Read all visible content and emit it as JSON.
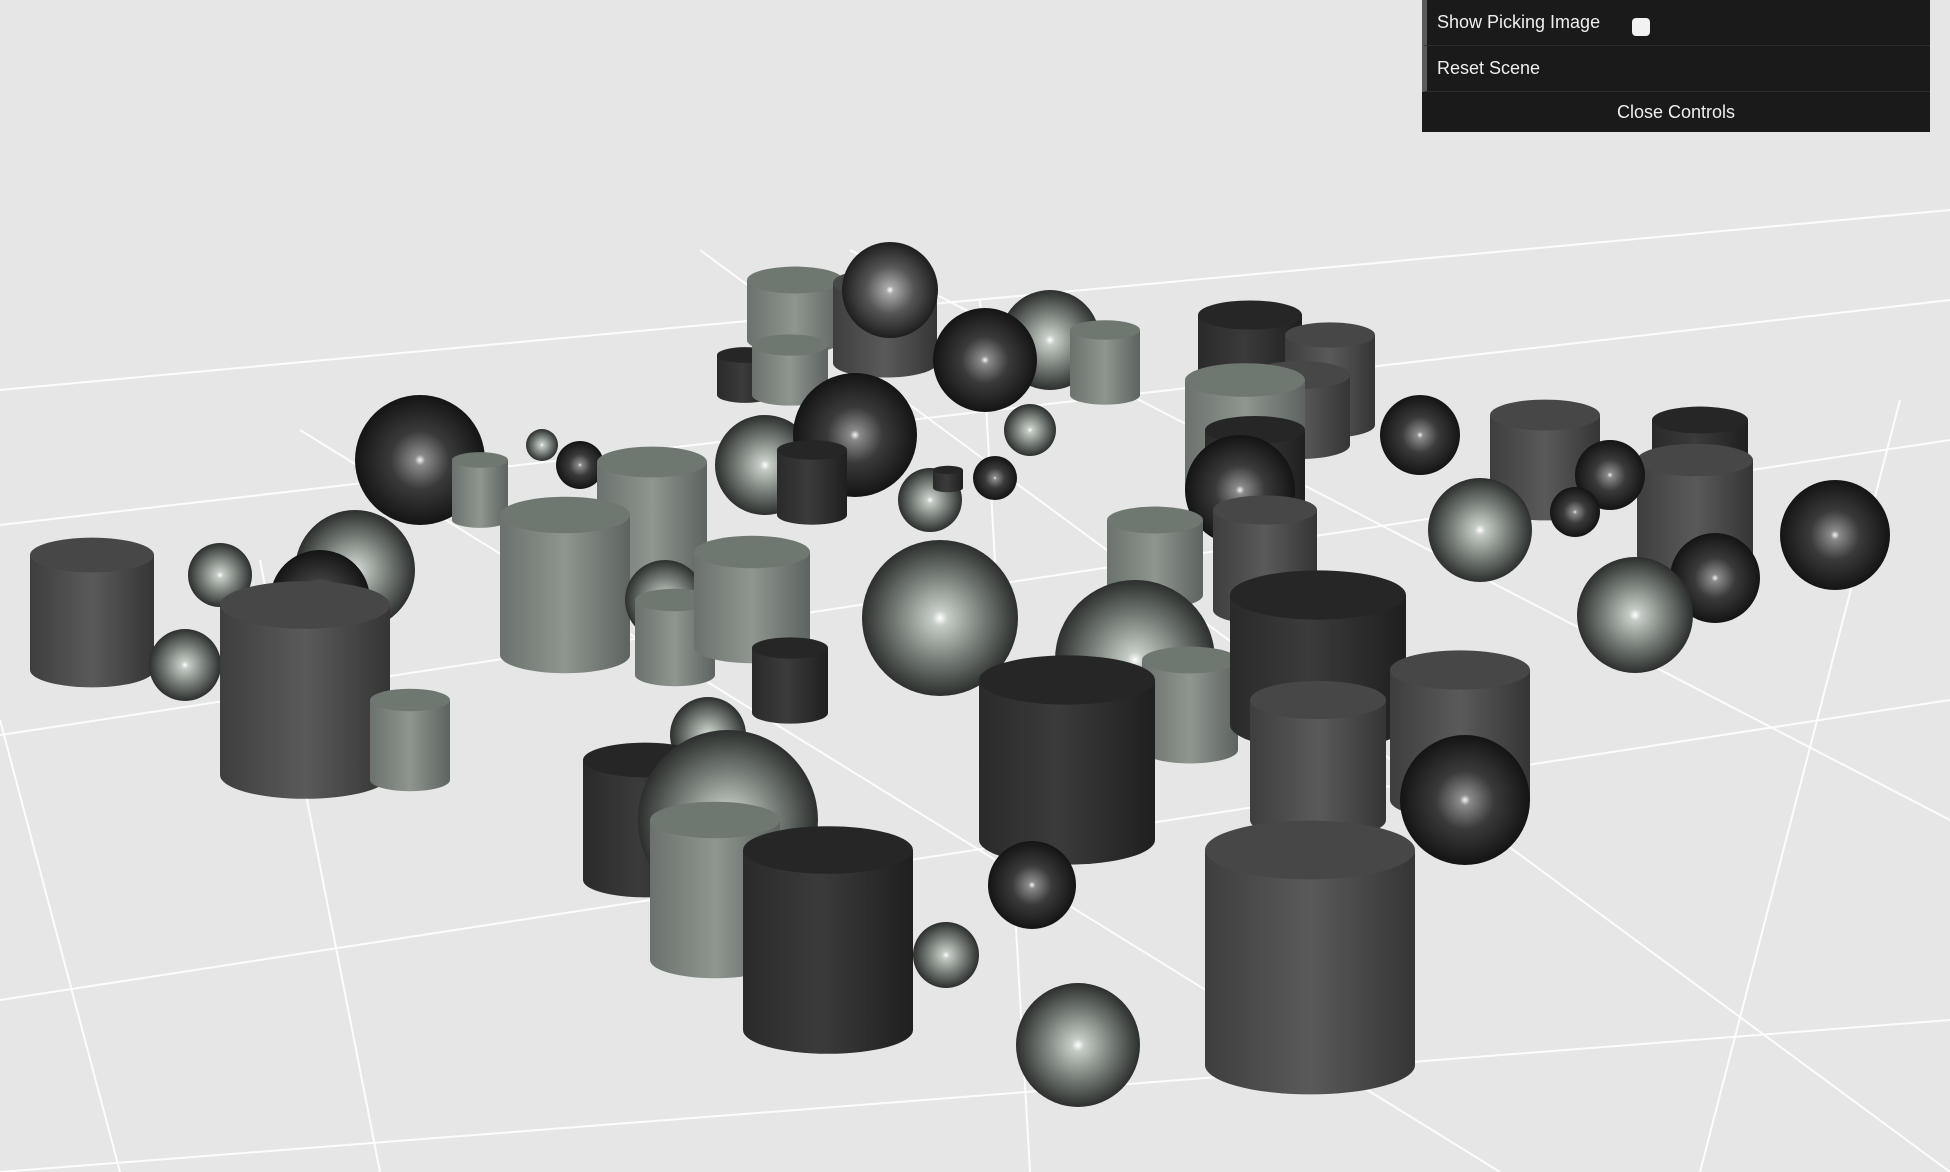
{
  "controls": {
    "show_picking_label": "Show Picking Image",
    "show_picking_checked": false,
    "reset_label": "Reset Scene",
    "close_label": "Close Controls"
  },
  "scene": {
    "background": "#e6e6e6",
    "grid_color": "#ffffff",
    "shapes": [
      {
        "type": "cylinder",
        "tone": "mid"
      },
      {
        "type": "cylinder",
        "tone": "light"
      },
      {
        "type": "sphere",
        "tone": "light"
      },
      {
        "type": "sphere",
        "tone": "dark"
      },
      {
        "type": "cylinder",
        "tone": "dark"
      },
      {
        "type": "sphere",
        "tone": "mid"
      }
    ]
  }
}
